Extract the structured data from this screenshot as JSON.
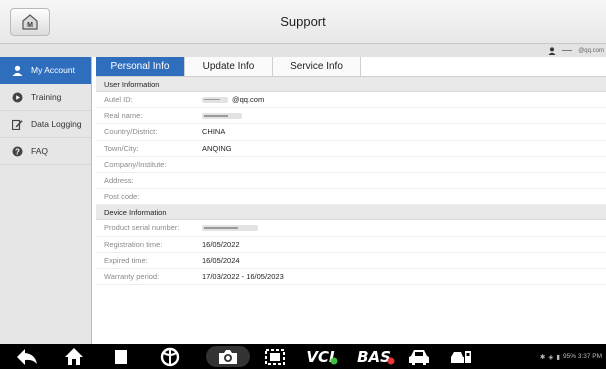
{
  "header": {
    "title": "Support"
  },
  "user": {
    "email": "@qq.com"
  },
  "sidebar": {
    "items": [
      {
        "label": "My Account",
        "icon": "person-icon"
      },
      {
        "label": "Training",
        "icon": "play-icon"
      },
      {
        "label": "Data Logging",
        "icon": "edit-icon"
      },
      {
        "label": "FAQ",
        "icon": "question-icon"
      }
    ]
  },
  "tabs": [
    {
      "label": "Personal Info"
    },
    {
      "label": "Update Info"
    },
    {
      "label": "Service Info"
    }
  ],
  "user_information": {
    "title": "User Information",
    "rows": [
      {
        "label": "Autel ID:",
        "value": "@qq.com"
      },
      {
        "label": "Real name:",
        "value": ""
      },
      {
        "label": "Country/District:",
        "value": "CHINA"
      },
      {
        "label": "Town/City:",
        "value": "ANQING"
      },
      {
        "label": "Company/Institute:",
        "value": ""
      },
      {
        "label": "Address:",
        "value": ""
      },
      {
        "label": "Post code:",
        "value": ""
      }
    ]
  },
  "device_information": {
    "title": "Device Information",
    "rows": [
      {
        "label": "Product serial number:",
        "value": ""
      },
      {
        "label": "Registration time:",
        "value": "16/05/2022"
      },
      {
        "label": "Expired time:",
        "value": "16/05/2024"
      },
      {
        "label": "Warranty period:",
        "value": "17/03/2022 - 16/05/2023"
      }
    ]
  },
  "navbar": {
    "vci_label": "VCI",
    "bas_label": "BAS",
    "status_text": "95% 3:37 PM"
  },
  "colors": {
    "accent": "#2f6ebd",
    "nav_bg": "#000000"
  }
}
